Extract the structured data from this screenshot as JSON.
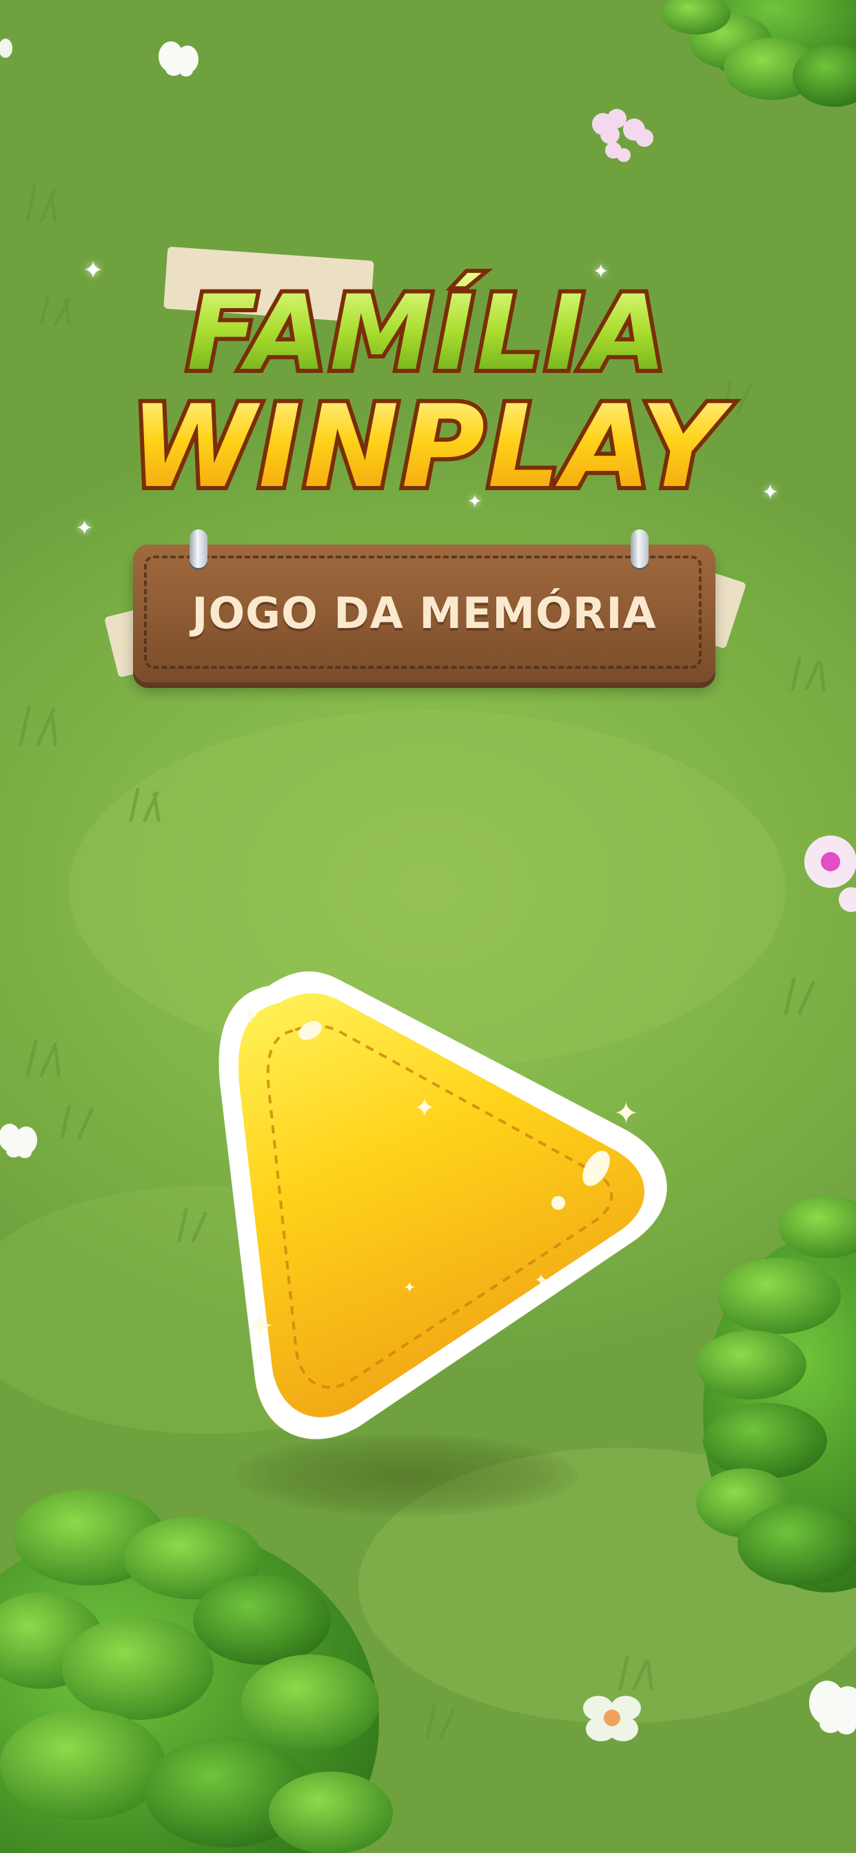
{
  "game": {
    "title_line1": "FAMÍLIA",
    "title_line2": "WINPLAY",
    "subtitle": "JOGO DA MEMÓRIA"
  },
  "controls": {
    "play_icon": "play-icon"
  },
  "colors": {
    "background": "#86b94c",
    "title_green": "#b6e43f",
    "title_yellow": "#ffd21a",
    "title_outline": "#8a3a0c",
    "sign_wood": "#8c5a33",
    "sign_text": "#fbe9cf",
    "play_yellow": "#ffd21a"
  }
}
